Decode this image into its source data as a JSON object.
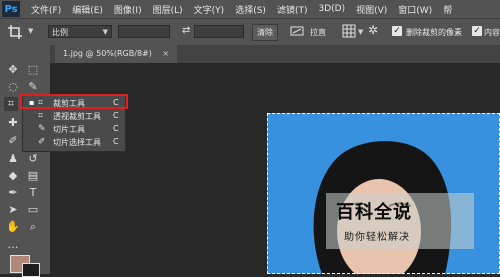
{
  "app": {
    "logo": "Ps"
  },
  "menu": [
    "文件(F)",
    "编辑(E)",
    "图像(I)",
    "图层(L)",
    "文字(Y)",
    "选择(S)",
    "滤镜(T)",
    "3D(D)",
    "视图(V)",
    "窗口(W)",
    "帮"
  ],
  "options_bar": {
    "ratio_select": "比例",
    "clear_button": "清除",
    "straighten_label": "拉直",
    "delete_cropped_label": "删除裁剪的像素",
    "content_aware_label": "内容"
  },
  "document_tab": {
    "title": "1.jpg @ 50%(RGB/8#)",
    "close": "×"
  },
  "tool_flyout": {
    "items": [
      {
        "label": "裁剪工具",
        "key": "C",
        "icon": "crop-icon",
        "selected": true
      },
      {
        "label": "透视裁剪工具",
        "key": "C",
        "icon": "perspective-crop-icon",
        "selected": false
      },
      {
        "label": "切片工具",
        "key": "C",
        "icon": "slice-icon",
        "selected": false
      },
      {
        "label": "切片选择工具",
        "key": "C",
        "icon": "slice-select-icon",
        "selected": false
      }
    ]
  },
  "watermark": {
    "title": "百科全说",
    "subtitle": "助你轻松解决"
  },
  "colors": {
    "photo_background": "#3891de",
    "highlight": "#e0201e",
    "foreground_swatch": "#b08779"
  }
}
